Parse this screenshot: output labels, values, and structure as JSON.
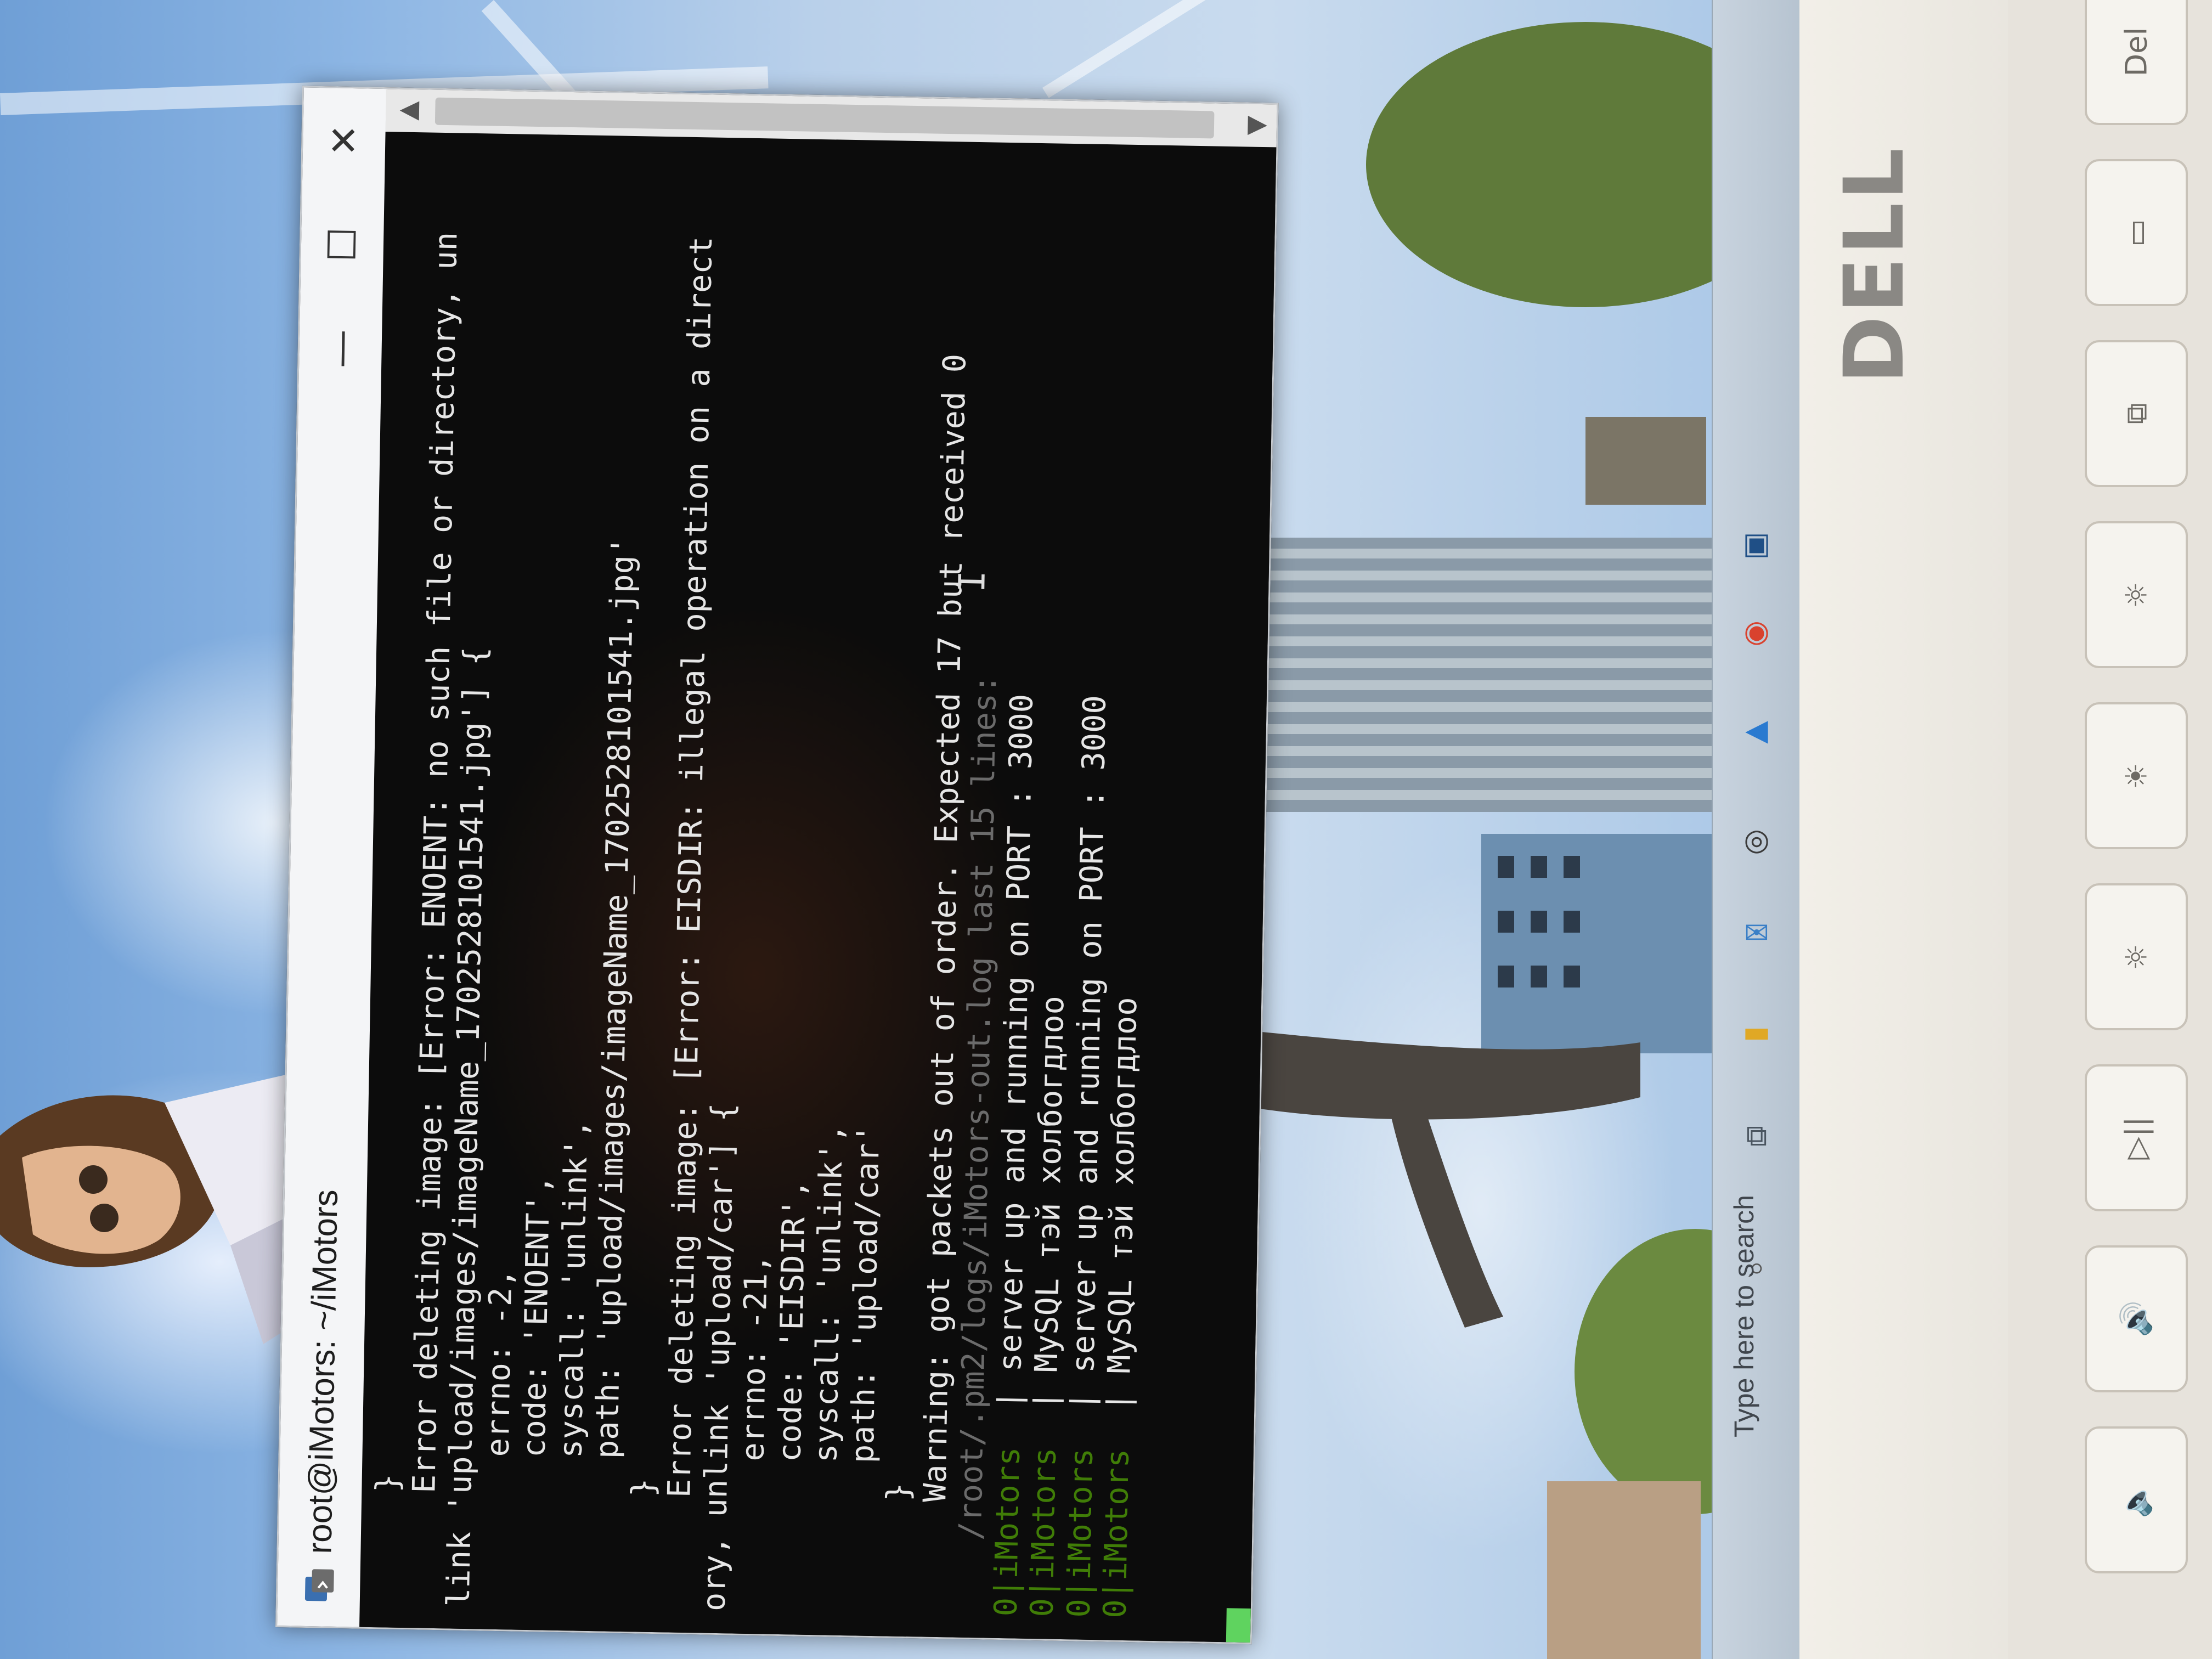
{
  "window": {
    "title": "root@iMotors: ~/iMotors",
    "minimize_icon": "—",
    "maximize_icon": "☐",
    "close_icon": "✕"
  },
  "terminal": {
    "lines": [
      {
        "prefix": "    ",
        "prefix_style": "pfx",
        "text": "  }"
      },
      {
        "prefix": "    ",
        "prefix_style": "pfx",
        "text": "  Error deleting image: [Error: ENOENT: no such file or directory, un"
      },
      {
        "prefix": "",
        "prefix_style": "",
        "text": "link 'upload/images/imageName_1702528101541.jpg'] {"
      },
      {
        "prefix": "    ",
        "prefix_style": "pfx",
        "text": "    errno: -2,"
      },
      {
        "prefix": "    ",
        "prefix_style": "pfx",
        "text": "    code: 'ENOENT',"
      },
      {
        "prefix": "    ",
        "prefix_style": "pfx",
        "text": "    syscall: 'unlink',"
      },
      {
        "prefix": "    ",
        "prefix_style": "pfx",
        "text": "    path: 'upload/images/imageName_1702528101541.jpg'"
      },
      {
        "prefix": "    ",
        "prefix_style": "pfx",
        "text": "  }"
      },
      {
        "prefix": "    ",
        "prefix_style": "pfx",
        "text": "  Error deleting image: [Error: EISDIR: illegal operation on a direct"
      },
      {
        "prefix": "",
        "prefix_style": "",
        "text": "ory, unlink 'upload/car'] {"
      },
      {
        "prefix": "    ",
        "prefix_style": "pfx",
        "text": "    errno: -21,"
      },
      {
        "prefix": "    ",
        "prefix_style": "pfx",
        "text": "    code: 'EISDIR',"
      },
      {
        "prefix": "    ",
        "prefix_style": "pfx",
        "text": "    syscall: 'unlink',"
      },
      {
        "prefix": "    ",
        "prefix_style": "pfx",
        "text": "    path: 'upload/car'"
      },
      {
        "prefix": "    ",
        "prefix_style": "pfx",
        "text": "  }"
      },
      {
        "prefix": "    ",
        "prefix_style": "pfx",
        "text": "  Warning: got packets out of order. Expected 17 but received 0"
      },
      {
        "prefix": "",
        "prefix_style": "dim",
        "text": "    /root/.pm2/logs/iMotors-out.log last 15 lines:"
      },
      {
        "prefix": "0|iMotors",
        "prefix_style": "pfx-g",
        "text": "  | server up and running on PORT : 3000"
      },
      {
        "prefix": "0|iMotors",
        "prefix_style": "pfx-g",
        "text": "  | MySQL тэй холбогдлоо"
      },
      {
        "prefix": "0|iMotors",
        "prefix_style": "pfx-g",
        "text": "  | server up and running on PORT : 3000"
      },
      {
        "prefix": "0|iMotors",
        "prefix_style": "pfx-g",
        "text": "  | MySQL тэй холбогдлоо"
      }
    ]
  },
  "taskbar": {
    "search_placeholder": "Type here to search",
    "icons": [
      "search-icon",
      "task-view-icon",
      "file-explorer-icon",
      "mail-icon",
      "dell-icon",
      "vscode-icon",
      "chrome-icon",
      "app-icon"
    ]
  },
  "laptop": {
    "brand": "DELL"
  },
  "colors": {
    "terminal_bg": "#0c0c0c",
    "terminal_text": "#e6e6e6",
    "titlebar_bg": "#f4f5f7",
    "prompt_green": "#4e9a06"
  }
}
